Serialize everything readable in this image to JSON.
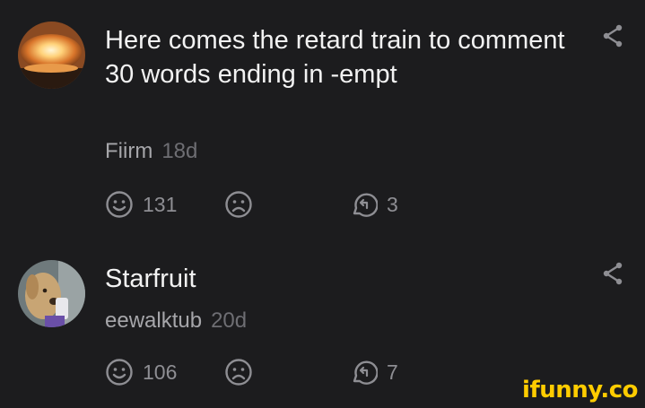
{
  "comments": [
    {
      "text": "Here comes the retard train to comment 30 words ending in -empt",
      "username": "Fiirm",
      "time": "18d",
      "smile_count": "131",
      "reply_count": "3",
      "avatar_icon": "explosion-avatar"
    },
    {
      "text": "Starfruit",
      "username": "eewalktub",
      "time": "20d",
      "smile_count": "106",
      "reply_count": "7",
      "avatar_icon": "dog-avatar"
    }
  ],
  "watermark": "ifunny.co",
  "colors": {
    "background": "#1c1c1e",
    "icon": "#8e8e93",
    "brand": "#ffcc00"
  }
}
